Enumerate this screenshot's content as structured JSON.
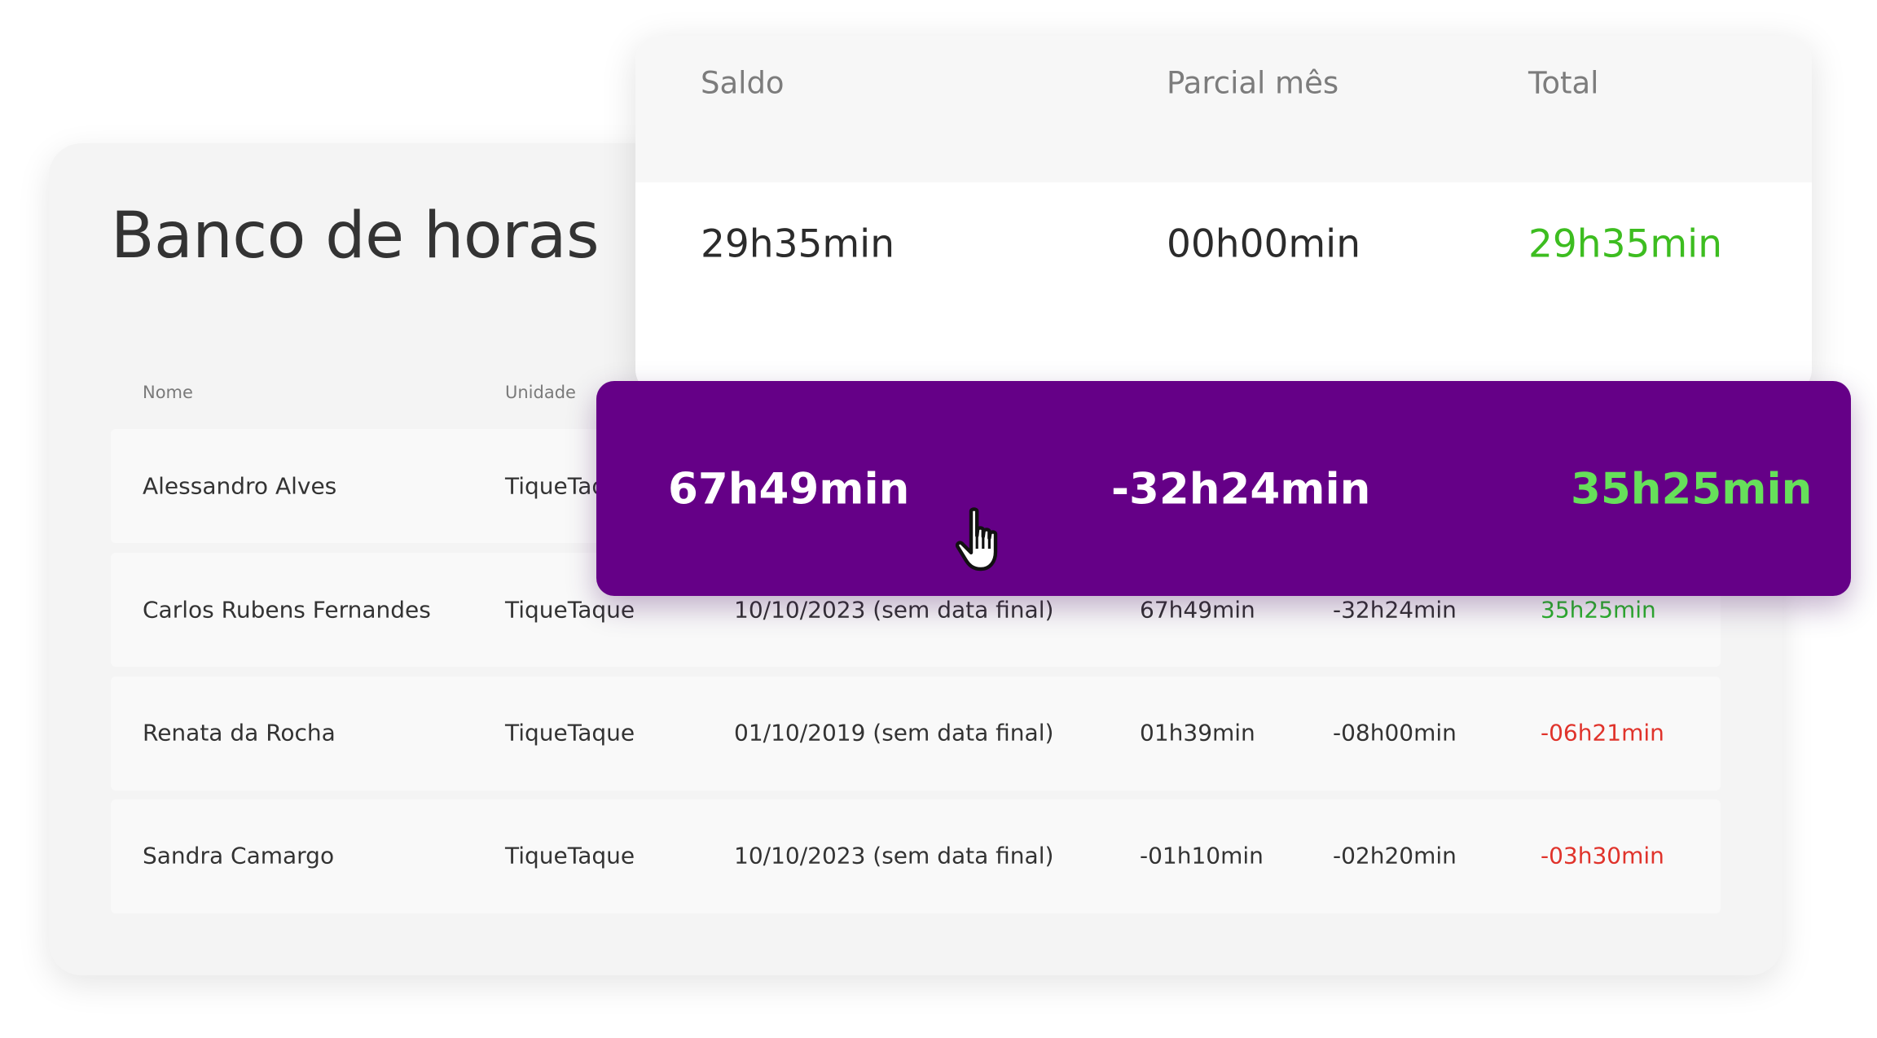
{
  "page": {
    "title": "Banco de horas"
  },
  "table": {
    "columns": [
      "Nome",
      "Unidade"
    ],
    "rows": [
      {
        "nome": "Alessandro Alves",
        "unidade": "TiqueTaque",
        "periodo": "",
        "saldo": "",
        "parcial": "",
        "total": "",
        "total_status": ""
      },
      {
        "nome": "Carlos Rubens Fernandes",
        "unidade": "TiqueTaque",
        "periodo": "10/10/2023 (sem data final)",
        "saldo": "67h49min",
        "parcial": "-32h24min",
        "total": "35h25min",
        "total_status": "positive"
      },
      {
        "nome": "Renata da Rocha",
        "unidade": "TiqueTaque",
        "periodo": "01/10/2019 (sem data final)",
        "saldo": "01h39min",
        "parcial": "-08h00min",
        "total": "-06h21min",
        "total_status": "negative"
      },
      {
        "nome": "Sandra Camargo",
        "unidade": "TiqueTaque",
        "periodo": "10/10/2023 (sem data final)",
        "saldo": "-01h10min",
        "parcial": "-02h20min",
        "total": "-03h30min",
        "total_status": "negative"
      }
    ]
  },
  "summary_card": {
    "headers": {
      "saldo": "Saldo",
      "parcial": "Parcial mês",
      "total": "Total"
    },
    "values": {
      "saldo": "29h35min",
      "parcial": "00h00min",
      "total": "29h35min"
    }
  },
  "highlight": {
    "saldo": "67h49min",
    "parcial": "-32h24min",
    "total": "35h25min"
  },
  "icons": {
    "cursor": "hand-pointer-icon"
  },
  "colors": {
    "highlight_bg": "#650087",
    "positive": "#2bb52b",
    "negative": "#e0332b",
    "highlight_positive": "#66e05a"
  }
}
